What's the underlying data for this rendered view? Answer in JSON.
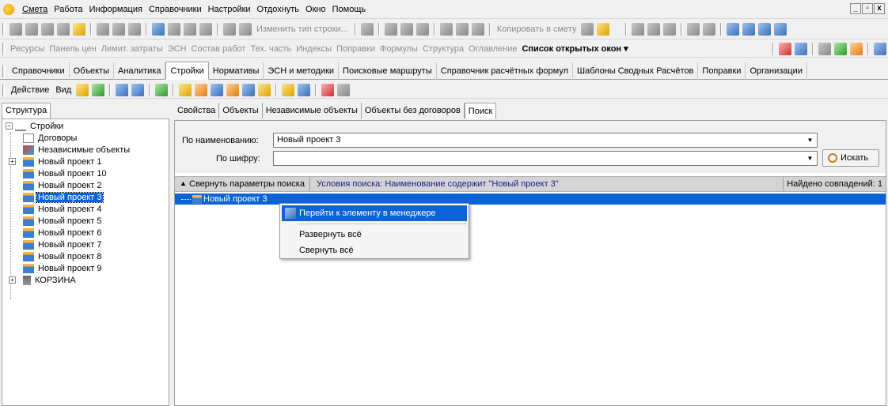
{
  "menubar": {
    "items": [
      "Смета",
      "Работа",
      "Информация",
      "Справочники",
      "Настройки",
      "Отдохнуть",
      "Окно",
      "Помощь"
    ],
    "window_controls": [
      "_",
      "▫",
      "x"
    ]
  },
  "toolbar1": {
    "change_row_type": "Изменить тип строки...",
    "copy_to_estimate": "Копировать в смету"
  },
  "toolbar2": {
    "links": [
      "Ресурсы",
      "Панель цен",
      "Лимит. затраты",
      "ЭСН",
      "Состав работ",
      "Тех. часть",
      "Индексы",
      "Поправки",
      "Формулы",
      "Структура",
      "Оглавление"
    ],
    "open_windows": "Список открытых окон ▾"
  },
  "main_tabs": {
    "items": [
      "Справочники",
      "Объекты",
      "Аналитика",
      "Стройки",
      "Нормативы",
      "ЭСН и методики",
      "Поисковые маршруты",
      "Справочник расчётных формул",
      "Шаблоны Сводных Расчётов",
      "Поправки",
      "Организации"
    ],
    "active": "Стройки"
  },
  "toolbar3": {
    "action": "Действие",
    "view": "Вид"
  },
  "left_panel": {
    "tab": "Структура",
    "tree": {
      "root": "Стройки",
      "contracts": "Договоры",
      "independent": "Независимые объекты",
      "projects": [
        "Новый проект 1",
        "Новый проект 10",
        "Новый проект 2",
        "Новый проект 3",
        "Новый проект 4",
        "Новый проект 5",
        "Новый проект 6",
        "Новый проект 7",
        "Новый проект 8",
        "Новый проект 9"
      ],
      "selected": "Новый проект 3",
      "trash": "КОРЗИНА"
    }
  },
  "right_panel": {
    "tabs": [
      "Свойства",
      "Объекты",
      "Независимые объекты",
      "Объекты без договоров",
      "Поиск"
    ],
    "active_tab": "Поиск",
    "search": {
      "by_name_label": "По наименованию:",
      "by_name_value": "Новый проект 3",
      "by_code_label": "По шифру:",
      "by_code_value": "",
      "search_button": "Искать"
    },
    "status": {
      "collapse": "Свернуть параметры поиска",
      "conditions": "Условия поиска: Наименование содержит \"Новый проект 3\"",
      "found": "Найдено совпадений: 1"
    },
    "result": "Новый проект 3"
  },
  "context_menu": {
    "items": [
      "Перейти к элементу в менеджере",
      "Развернуть всё",
      "Свернуть всё"
    ]
  }
}
